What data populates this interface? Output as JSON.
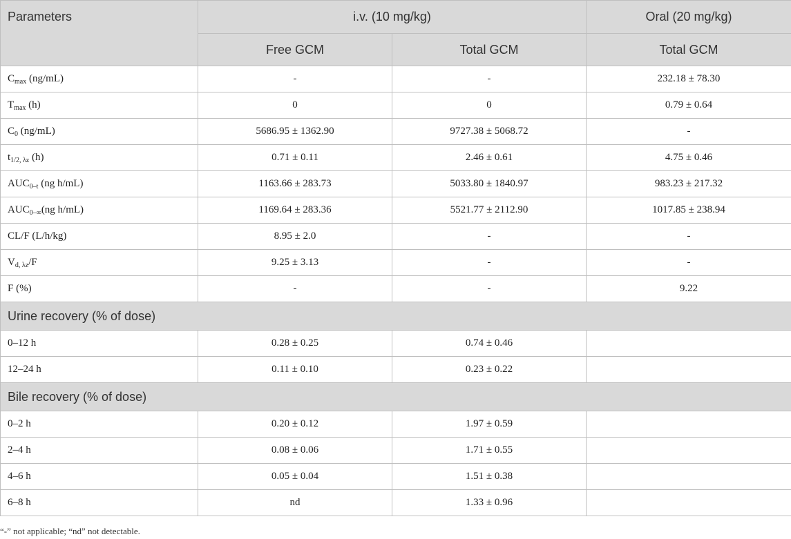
{
  "header": {
    "parameters": "Parameters",
    "iv_group": "i.v. (10 mg/kg)",
    "oral_group": "Oral (20 mg/kg)",
    "free_gcm": "Free GCM",
    "total_gcm_iv": "Total GCM",
    "total_gcm_oral": "Total GCM"
  },
  "rows": [
    {
      "p": "C",
      "s": "max",
      "t": " (ng/mL)",
      "v": [
        "-",
        "-",
        "232.18 ± 78.30"
      ]
    },
    {
      "p": "T",
      "s": "max",
      "t": " (h)",
      "v": [
        "0",
        "0",
        "0.79 ± 0.64"
      ]
    },
    {
      "p": "C",
      "s": "0",
      "t": " (ng/mL)",
      "v": [
        "5686.95 ± 1362.90",
        "9727.38 ± 5068.72",
        "-"
      ]
    },
    {
      "p": "t",
      "s": "1/2, λz",
      "t": " (h)",
      "v": [
        "0.71 ± 0.11",
        "2.46 ± 0.61",
        "4.75 ± 0.46"
      ]
    },
    {
      "p": "AUC",
      "s": "0–t",
      "t": " (ng h/mL)",
      "v": [
        "1163.66 ± 283.73",
        "5033.80 ± 1840.97",
        "983.23 ± 217.32"
      ]
    },
    {
      "p": "AUC",
      "s": "0–∞",
      "t": "(ng h/mL)",
      "v": [
        "1169.64 ± 283.36",
        "5521.77 ± 2112.90",
        "1017.85 ± 238.94"
      ]
    },
    {
      "p": "CL/F (L/h/kg)",
      "s": "",
      "t": "",
      "v": [
        "8.95 ± 2.0",
        "-",
        "-"
      ]
    },
    {
      "p": "V",
      "s": "d, λz",
      "t": "/F",
      "v": [
        "9.25 ± 3.13",
        "-",
        "-"
      ]
    },
    {
      "p": "F (%)",
      "s": "",
      "t": "",
      "v": [
        "-",
        "-",
        "9.22"
      ]
    }
  ],
  "urine": {
    "title": "Urine recovery (% of dose)",
    "rows": [
      {
        "p": "0–12 h",
        "v": [
          "0.28 ± 0.25",
          "0.74 ± 0.46",
          ""
        ]
      },
      {
        "p": "12–24 h",
        "v": [
          "0.11 ± 0.10",
          "0.23 ± 0.22",
          ""
        ]
      }
    ]
  },
  "bile": {
    "title": "Bile recovery (% of dose)",
    "rows": [
      {
        "p": "0–2 h",
        "v": [
          "0.20 ± 0.12",
          "1.97 ± 0.59",
          ""
        ]
      },
      {
        "p": "2–4 h",
        "v": [
          "0.08 ± 0.06",
          "1.71 ± 0.55",
          ""
        ]
      },
      {
        "p": "4–6 h",
        "v": [
          "0.05 ± 0.04",
          "1.51 ± 0.38",
          ""
        ]
      },
      {
        "p": "6–8 h",
        "v": [
          "nd",
          "1.33 ± 0.96",
          ""
        ]
      }
    ]
  },
  "footnote": "“-” not applicable; “nd” not detectable."
}
